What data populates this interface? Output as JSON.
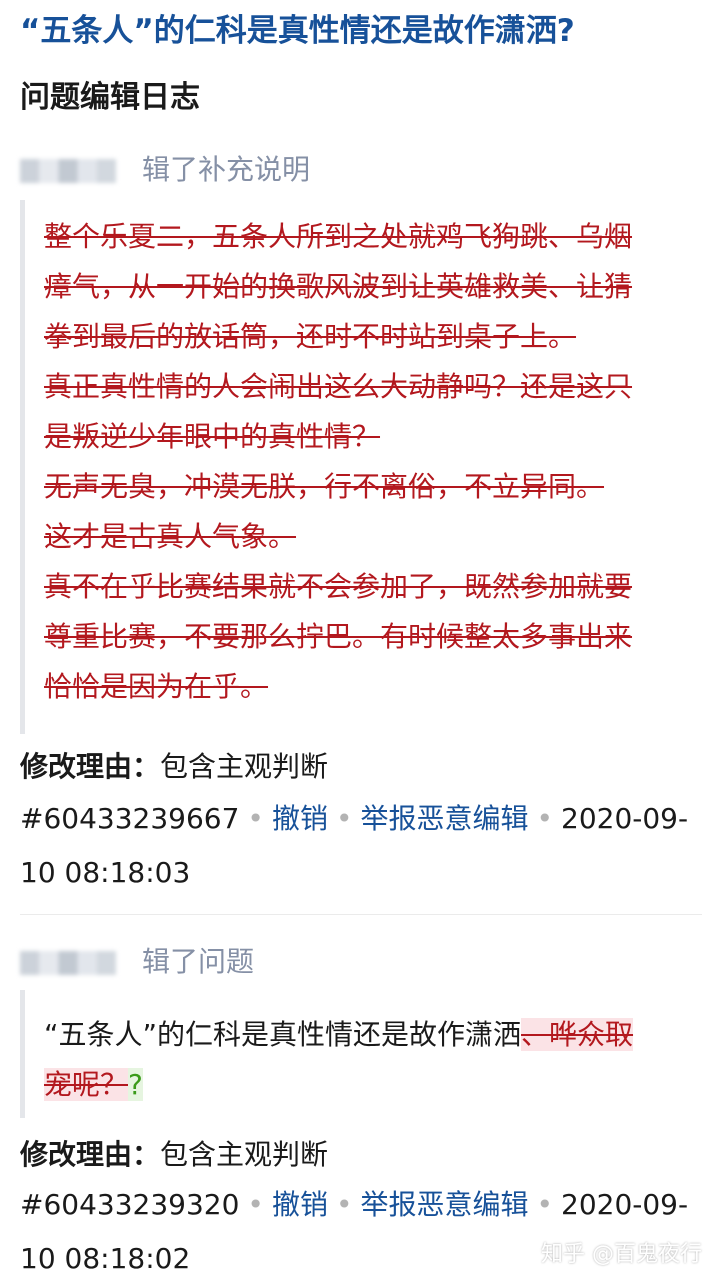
{
  "page_title": "“五条人”的仁科是真性情还是故作潇洒?",
  "log_heading": "问题编辑日志",
  "entries": [
    {
      "editor_suffix": "辑了补充说明",
      "removed_lines": [
        "整个乐夏二，五条人所到之处就鸡飞狗跳、乌烟",
        "瘴气，从一开始的换歌风波到让英雄救美、让猜",
        "拳到最后的放话筒，还时不时站到桌子上。",
        "真正真性情的人会闹出这么大动静吗？还是这只",
        "是叛逆少年眼中的真性情？",
        "无声无臭，冲漠无朕，行不离俗，不立异同。",
        "这才是古真人气象。",
        "真不在乎比赛结果就不会参加了，既然参加就要",
        "尊重比赛，不要那么拧巴。有时候整太多事出来",
        "恰恰是因为在乎。"
      ],
      "reason_label": "修改理由：",
      "reason": "包含主观判断",
      "id": "#60433239667",
      "undo": "撤销",
      "report": "举报恶意编辑",
      "time_line1": "2020-09-",
      "time_line2": "10 08:18:03"
    },
    {
      "editor_suffix": "辑了问题",
      "kept_text": "“五条人”的仁科是真性情还是故作潇洒",
      "deleted_line1": "、哗众取",
      "deleted_line2": "宠呢？",
      "inserted": "?",
      "reason_label": "修改理由：",
      "reason": "包含主观判断",
      "id": "#60433239320",
      "undo": "撤销",
      "report": "举报恶意编辑",
      "time_line1": "2020-09-",
      "time_line2": "10 08:18:02"
    }
  ],
  "separator": "•",
  "watermark": "知乎 @百鬼夜行"
}
